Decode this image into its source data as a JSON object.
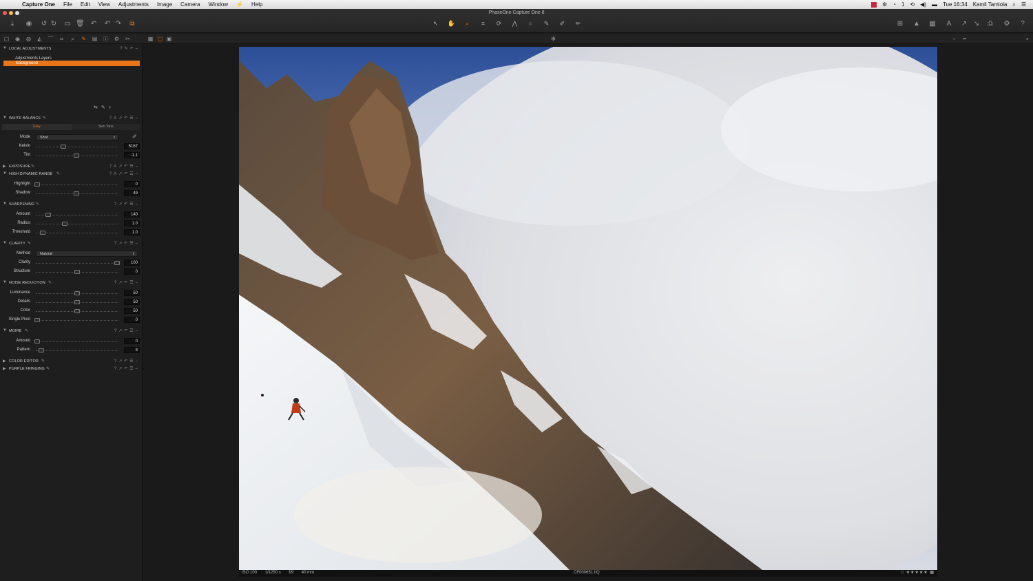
{
  "menubar": {
    "app": "Capture One",
    "menus": [
      "File",
      "Edit",
      "View",
      "Adjustments",
      "Image",
      "Camera",
      "Window",
      "Help"
    ],
    "clock": "Tue 16:34",
    "user": "Kamil Tamiola",
    "status_extra": "1"
  },
  "window": {
    "title": "PhaseOne Capture One 8"
  },
  "left_panel": {
    "local_adjustments": {
      "title": "LOCAL ADJUSTMENTS",
      "layers_label": "Adjustments Layers",
      "layer_selected": "Background"
    },
    "white_balance": {
      "title": "WHITE BALANCE",
      "tabs": [
        "Grey",
        "Skin Tone"
      ],
      "mode_label": "Mode",
      "mode_value": "Shot",
      "kelvin_label": "Kelvin",
      "kelvin_value": "5167",
      "tint_label": "Tint",
      "tint_value": "-1.1"
    },
    "exposure": {
      "title": "EXPOSURE"
    },
    "hdr": {
      "title": "HIGH DYNAMIC RANGE",
      "highlight_label": "Highlight",
      "highlight_value": "0",
      "shadow_label": "Shadow",
      "shadow_value": "49"
    },
    "sharpening": {
      "title": "SHARPENING",
      "amount_label": "Amount",
      "amount_value": "140",
      "radius_label": "Radius",
      "radius_value": "1.0",
      "threshold_label": "Threshold",
      "threshold_value": "1.0"
    },
    "clarity": {
      "title": "CLARITY",
      "method_label": "Method",
      "method_value": "Natural",
      "clarity_label": "Clarity",
      "clarity_value": "100",
      "structure_label": "Structure",
      "structure_value": "0"
    },
    "noise_reduction": {
      "title": "NOISE REDUCTION",
      "luminance_label": "Luminance",
      "luminance_value": "50",
      "details_label": "Details",
      "details_value": "50",
      "color_label": "Color",
      "color_value": "50",
      "single_pixel_label": "Single Pixel",
      "single_pixel_value": "0"
    },
    "moire": {
      "title": "MOIRE",
      "amount_label": "Amount",
      "amount_value": "0",
      "pattern_label": "Pattern",
      "pattern_value": "8"
    },
    "color_editor": {
      "title": "COLOR EDITOR"
    },
    "purple_fringing": {
      "title": "PURPLE FRINGING"
    }
  },
  "viewer": {
    "iso": "ISO 100",
    "shutter": "1/1250 s",
    "aperture": "f/9",
    "focal": "40 mm",
    "filename": "CF000651.IIQ",
    "stars": "★★★★★"
  },
  "colors": {
    "accent": "#e8751a",
    "panel_bg": "#1e1e1e",
    "toolbar_bg": "#2a2a2a",
    "sky": "#3a5fa8"
  }
}
